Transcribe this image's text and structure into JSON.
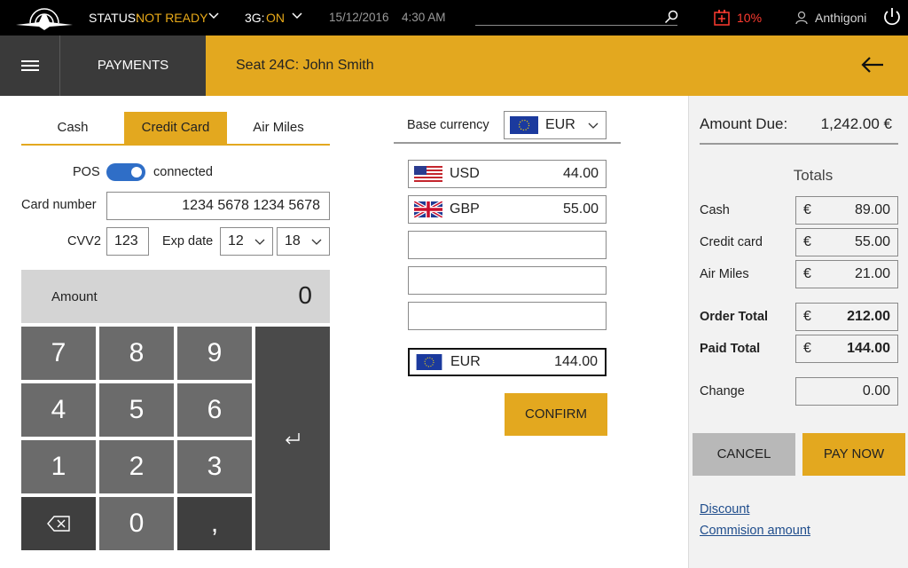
{
  "status_bar": {
    "status_label": "STATUS:",
    "status_value": "NOT READY",
    "network_label": "3G:",
    "network_value": "ON",
    "date": "15/12/2016",
    "time": "4:30 AM",
    "battery": "10%",
    "user": "Anthigoni",
    "icons": [
      "airplane-logo-icon",
      "chevron-down-icon",
      "search-icon",
      "battery-icon",
      "user-icon",
      "power-icon"
    ]
  },
  "header": {
    "section": "PAYMENTS",
    "seat": "Seat 24C: John Smith",
    "back_icon": "arrow-left-icon",
    "menu_icon": "hamburger-icon"
  },
  "tabs": [
    "Cash",
    "Credit Card",
    "Air Miles"
  ],
  "active_tab": "Credit Card",
  "card_form": {
    "pos_label": "POS",
    "pos_status": "connected",
    "card_number_label": "Card number",
    "card_number": "1234 5678 1234 5678",
    "cvv_label": "CVV2",
    "cvv": "123",
    "exp_label": "Exp date",
    "exp_month": "12",
    "exp_year": "18"
  },
  "keypad": {
    "amount_label": "Amount",
    "amount_value": "0",
    "keys": [
      "7",
      "8",
      "9",
      "4",
      "5",
      "6",
      "1",
      "2",
      "3",
      "0",
      ","
    ],
    "backspace_icon": "backspace-icon",
    "enter_icon": "enter-icon"
  },
  "currency": {
    "base_label": "Base currency",
    "base_value": "EUR",
    "rows": [
      {
        "code": "USD",
        "amount": "44.00",
        "flag": "us-flag-icon"
      },
      {
        "code": "GBP",
        "amount": "55.00",
        "flag": "uk-flag-icon"
      },
      {
        "code": "",
        "amount": ""
      },
      {
        "code": "",
        "amount": ""
      },
      {
        "code": "",
        "amount": ""
      }
    ],
    "total": {
      "code": "EUR",
      "amount": "144.00",
      "flag": "eu-flag-icon"
    },
    "confirm_label": "CONFIRM"
  },
  "summary": {
    "amount_due_label": "Amount Due:",
    "amount_due": "1,242.00 €",
    "totals_title": "Totals",
    "currency_symbol": "€",
    "rows": [
      {
        "label": "Cash",
        "value": "89.00"
      },
      {
        "label": "Credit card",
        "value": "55.00"
      },
      {
        "label": "Air Miles",
        "value": "21.00"
      },
      {
        "label": "Order Total",
        "value": "212.00"
      },
      {
        "label": "Paid Total",
        "value": "144.00"
      }
    ],
    "change_label": "Change",
    "change_value": "0.00",
    "cancel_label": "CANCEL",
    "pay_label": "PAY NOW",
    "discount_link": "Discount",
    "commission_link": "Commision amount"
  },
  "colors": {
    "accent": "#e3a81f",
    "toggle": "#2f6ec7",
    "battery_low": "#ff3b30"
  }
}
